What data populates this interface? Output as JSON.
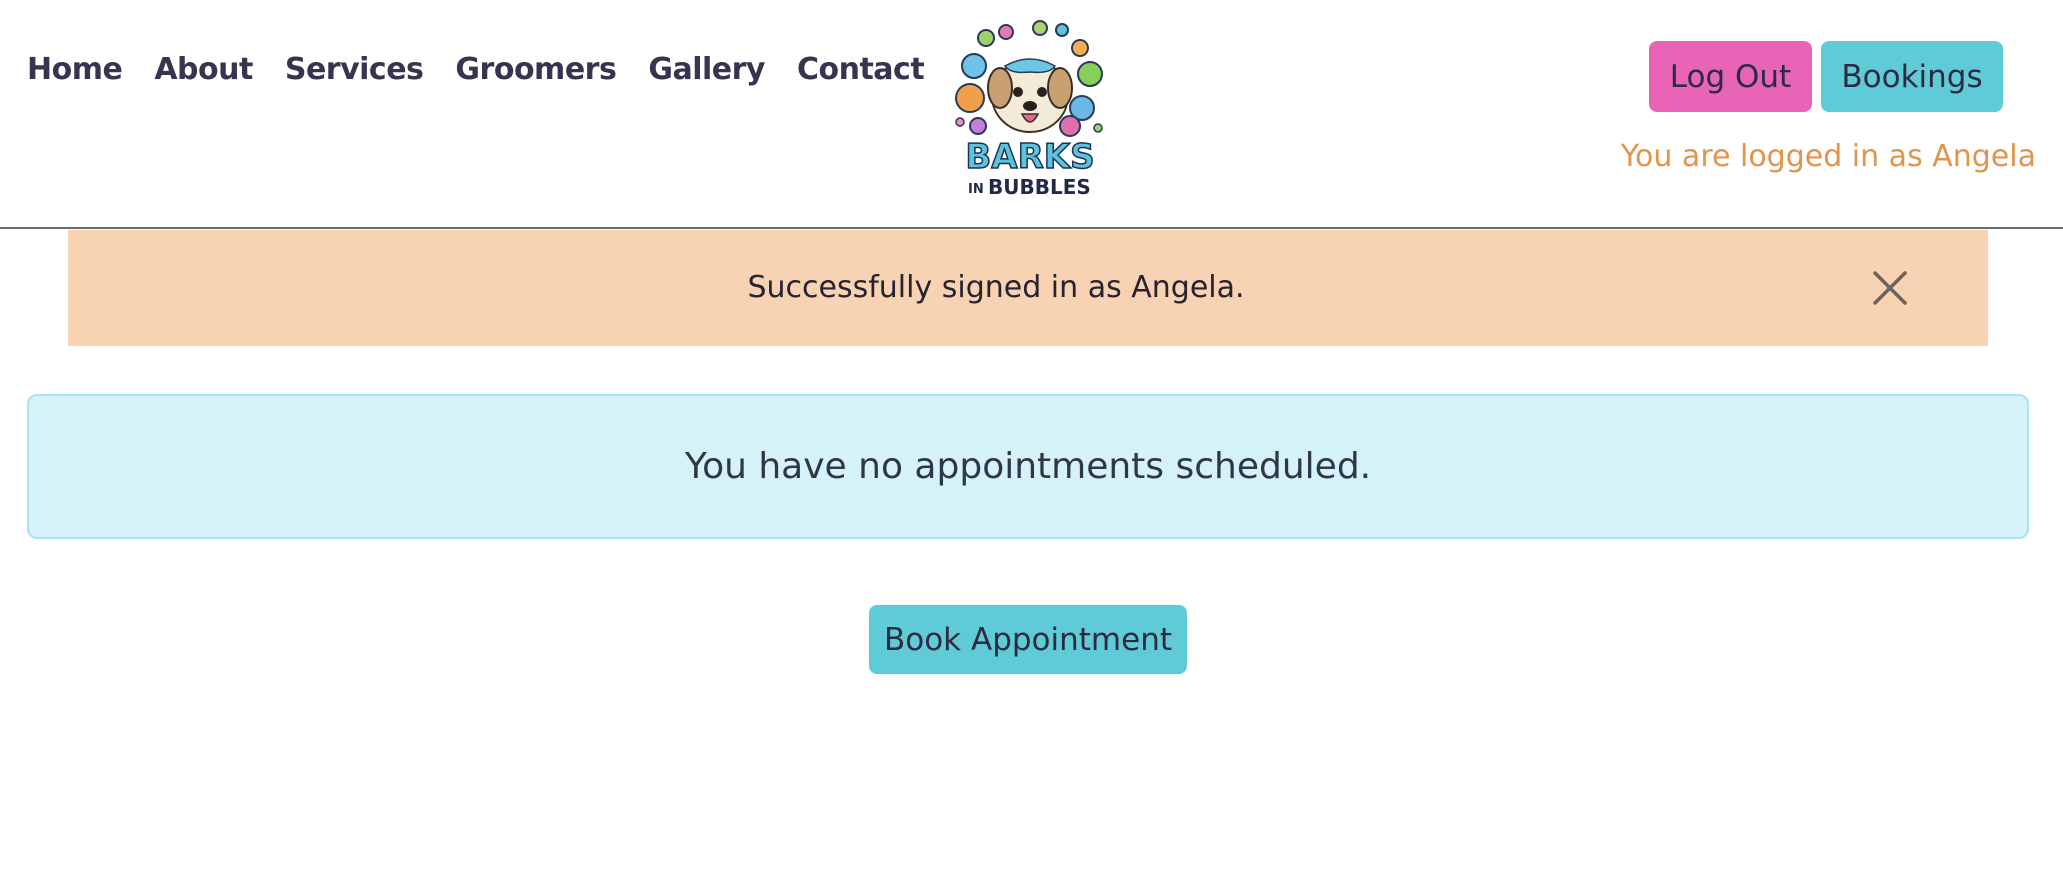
{
  "nav": {
    "items": [
      {
        "label": "Home"
      },
      {
        "label": "About"
      },
      {
        "label": "Services"
      },
      {
        "label": "Groomers"
      },
      {
        "label": "Gallery"
      },
      {
        "label": "Contact"
      }
    ]
  },
  "logo": {
    "line1": "BARKS",
    "line2_prefix": "IN",
    "line2": "BUBBLES"
  },
  "auth": {
    "logout_label": "Log Out",
    "bookings_label": "Bookings",
    "status_text": "You are logged in as Angela"
  },
  "flash": {
    "message": "Successfully signed in as Angela.",
    "close_icon": "close-icon"
  },
  "appointments": {
    "empty_message": "You have no appointments scheduled.",
    "book_label": "Book Appointment"
  },
  "colors": {
    "pink": "#e864b6",
    "teal": "#5ecbd7",
    "orange_text": "#e1944a",
    "flash_bg": "#f7d3b3",
    "info_bg": "#d5f2f9"
  }
}
